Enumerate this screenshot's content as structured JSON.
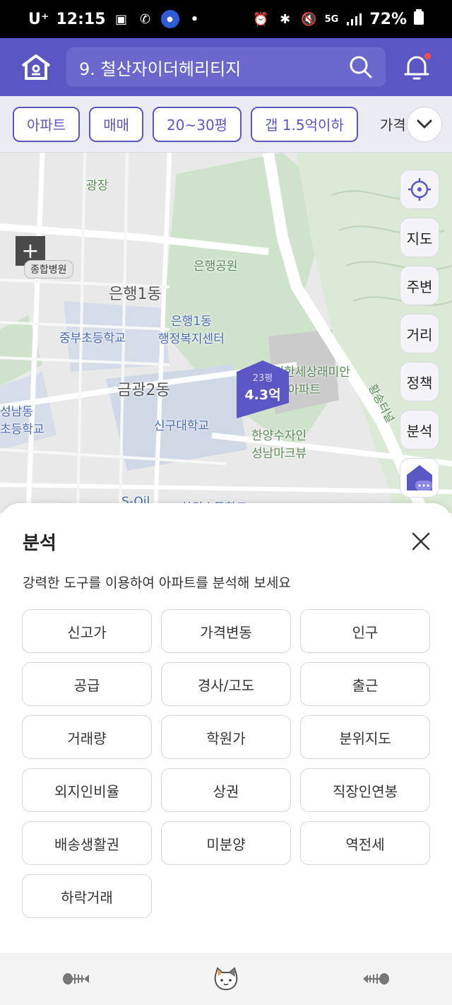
{
  "status_bar": {
    "carrier": "U⁺",
    "time": "12:15",
    "battery": "72%",
    "network": "5G",
    "left_icons": [
      "image-icon",
      "wifi-call-icon",
      "app-badge-icon"
    ],
    "right_icons": [
      "alarm-icon",
      "bluetooth-icon",
      "mute-icon",
      "signal-icon",
      "battery-icon"
    ]
  },
  "header": {
    "search_value": "9. 철산자이더헤리티지",
    "notification_dot": true,
    "accent_color": "#5a56c4"
  },
  "filters": {
    "chips": [
      "아파트",
      "매매",
      "20~30평",
      "갭 1.5억이하"
    ],
    "overflow_label": "가격"
  },
  "map": {
    "labels": {
      "plaza": "광장",
      "hospital": "종합병원",
      "park": "은행공원",
      "dong1": "은행1동",
      "center": "은행1동\n행정복지센터",
      "school1": "중부초등학교",
      "dong2": "금광2동",
      "univ": "신구대학교",
      "school2": "성남동\n초등학교",
      "apt1": "e편한세상래미안\n금광아파트",
      "apt2": "한양수자인\n성남마크뷰",
      "tunnel": "황송터널",
      "bottom1": "금광2동",
      "bottom2": "S-Oil",
      "bottom3": "하원초등학교"
    },
    "marker": {
      "area": "23평",
      "price": "4.3억"
    },
    "buttons": [
      "지도",
      "주변",
      "거리",
      "정책",
      "분석"
    ]
  },
  "sheet": {
    "title": "분석",
    "description": "강력한 도구를 이용하여 아파트를 분석해 보세요",
    "tools": [
      "신고가",
      "가격변동",
      "인구",
      "공급",
      "경사/고도",
      "출근",
      "거래량",
      "학원가",
      "분위지도",
      "외지인비율",
      "상권",
      "직장인연봉",
      "배송생활권",
      "미분양",
      "역전세",
      "하락거래"
    ]
  },
  "bottom_nav": {
    "items": [
      "fish-bone-icon",
      "cat-face-icon",
      "fish-bone-icon"
    ]
  }
}
